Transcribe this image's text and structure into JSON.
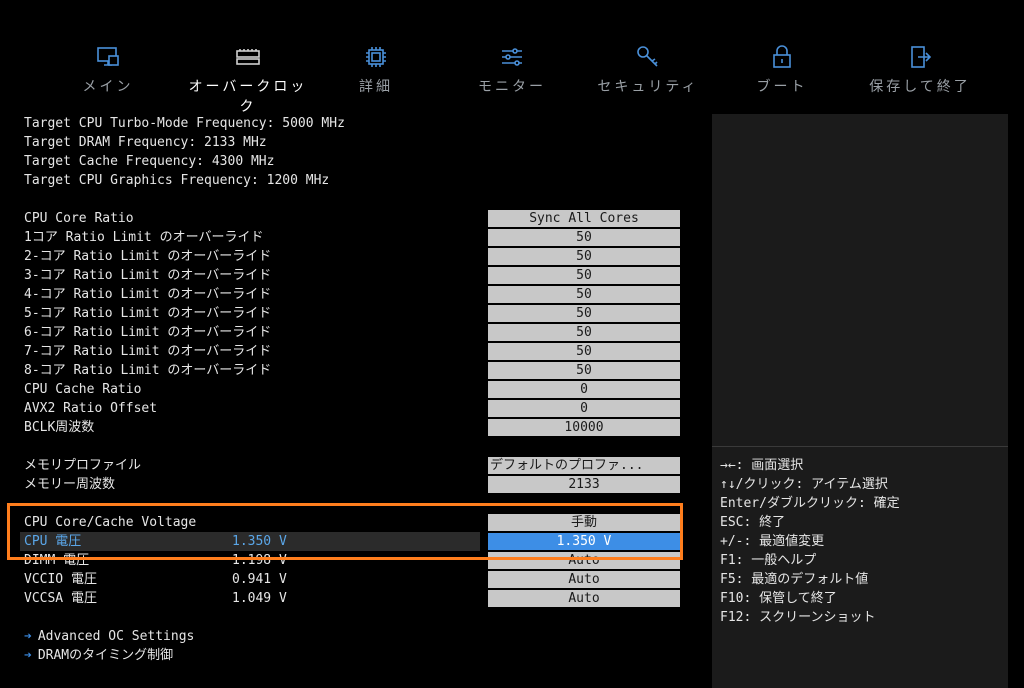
{
  "nav": {
    "tabs": [
      {
        "label": "メイン",
        "icon": "monitor-icon"
      },
      {
        "label": "オーバークロック",
        "icon": "memory-module-icon"
      },
      {
        "label": "詳細",
        "icon": "chip-icon"
      },
      {
        "label": "モニター",
        "icon": "sliders-icon"
      },
      {
        "label": "セキュリティ",
        "icon": "key-icon"
      },
      {
        "label": "ブート",
        "icon": "lock-icon"
      },
      {
        "label": "保存して終了",
        "icon": "exit-door-icon"
      }
    ],
    "active": "オーバークロック"
  },
  "info": [
    "Target CPU Turbo-Mode Frequency: 5000 MHz",
    "Target DRAM Frequency: 2133 MHz",
    "Target Cache Frequency: 4300 MHz",
    "Target CPU Graphics Frequency: 1200 MHz"
  ],
  "settings": [
    {
      "label": "CPU Core Ratio",
      "value": "Sync All Cores"
    },
    {
      "label": "1コア Ratio Limit のオーバーライド",
      "value": "50"
    },
    {
      "label": "2-コア Ratio Limit のオーバーライド",
      "value": "50"
    },
    {
      "label": "3-コア Ratio Limit のオーバーライド",
      "value": "50"
    },
    {
      "label": "4-コア Ratio Limit のオーバーライド",
      "value": "50"
    },
    {
      "label": "5-コア Ratio Limit のオーバーライド",
      "value": "50"
    },
    {
      "label": "6-コア Ratio Limit のオーバーライド",
      "value": "50"
    },
    {
      "label": "7-コア Ratio Limit のオーバーライド",
      "value": "50"
    },
    {
      "label": "8-コア Ratio Limit のオーバーライド",
      "value": "50"
    },
    {
      "label": "CPU Cache Ratio",
      "value": "0"
    },
    {
      "label": "AVX2 Ratio Offset",
      "value": "0"
    },
    {
      "label": "BCLK周波数",
      "value": "10000"
    }
  ],
  "memory": [
    {
      "label": "メモリプロファイル",
      "value": "デフォルトのプロファ..."
    },
    {
      "label": "メモリー周波数",
      "value": "2133"
    }
  ],
  "voltage": [
    {
      "label": "CPU Core/Cache Voltage",
      "current": "",
      "value": "手動"
    },
    {
      "label": "CPU 電圧",
      "current": "1.350 V",
      "value": "1.350 V"
    },
    {
      "label": "DIMM 電圧",
      "current": "1.198 V",
      "value": "Auto"
    },
    {
      "label": "VCCIO 電圧",
      "current": "0.941 V",
      "value": "Auto"
    },
    {
      "label": "VCCSA 電圧",
      "current": "1.049 V",
      "value": "Auto"
    }
  ],
  "submenus": [
    {
      "arrow": "➔",
      "label": "Advanced OC Settings"
    },
    {
      "arrow": "➔",
      "label": "DRAMのタイミング制御"
    }
  ],
  "help": [
    "→←: 画面選択",
    "↑↓/クリック: アイテム選択",
    "Enter/ダブルクリック: 確定",
    "ESC: 終了",
    "+/-: 最適値変更",
    "F1: 一般ヘルプ",
    "F5: 最適のデフォルト値",
    "F10: 保管して終了",
    "F12: スクリーンショット"
  ],
  "colors": {
    "accent": "#3d8ee6",
    "highlight_border": "#ff7e1d",
    "selected_text": "#5aa6e8"
  }
}
